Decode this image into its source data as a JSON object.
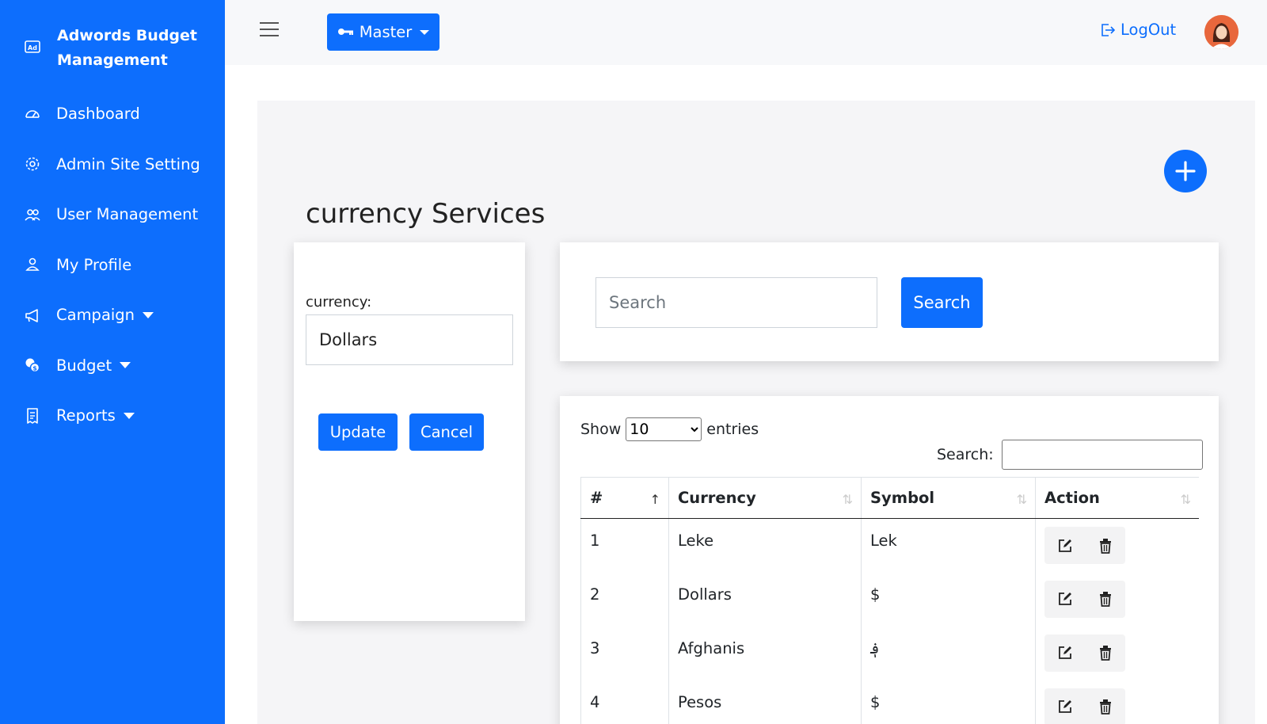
{
  "sidebar": {
    "brand_title": "Adwords Budget Management",
    "brand_icon": "ad-icon",
    "items": [
      {
        "label": "Dashboard",
        "icon": "speedometer-icon"
      },
      {
        "label": "Admin Site Setting",
        "icon": "gear-icon"
      },
      {
        "label": "User Management",
        "icon": "users-icon"
      },
      {
        "label": "My Profile",
        "icon": "person-icon"
      },
      {
        "label": "Campaign",
        "icon": "megaphone-icon"
      },
      {
        "label": "Budget",
        "icon": "coins-icon"
      },
      {
        "label": "Reports",
        "icon": "receipt-icon"
      }
    ]
  },
  "topbar": {
    "master_label": "Master",
    "logout_label": "LogOut"
  },
  "page": {
    "title": "currency Services"
  },
  "form": {
    "label": "currency:",
    "value": "Dollars",
    "update_label": "Update",
    "cancel_label": "Cancel"
  },
  "search": {
    "placeholder": "Search",
    "button_label": "Search"
  },
  "datatable": {
    "show_label": "Show",
    "entries_value": "10",
    "entries_label": "entries",
    "search_label": "Search:",
    "columns": [
      "#",
      "Currency",
      "Symbol",
      "Action"
    ],
    "rows": [
      {
        "num": "1",
        "currency": "Leke",
        "symbol": "Lek"
      },
      {
        "num": "2",
        "currency": "Dollars",
        "symbol": "$"
      },
      {
        "num": "3",
        "currency": "Afghanis",
        "symbol": "؋"
      },
      {
        "num": "4",
        "currency": "Pesos",
        "symbol": "$"
      }
    ]
  },
  "colors": {
    "primary": "#0d6efd",
    "panel_bg": "#f5f5f7",
    "topbar_bg": "#f7f8fa"
  }
}
